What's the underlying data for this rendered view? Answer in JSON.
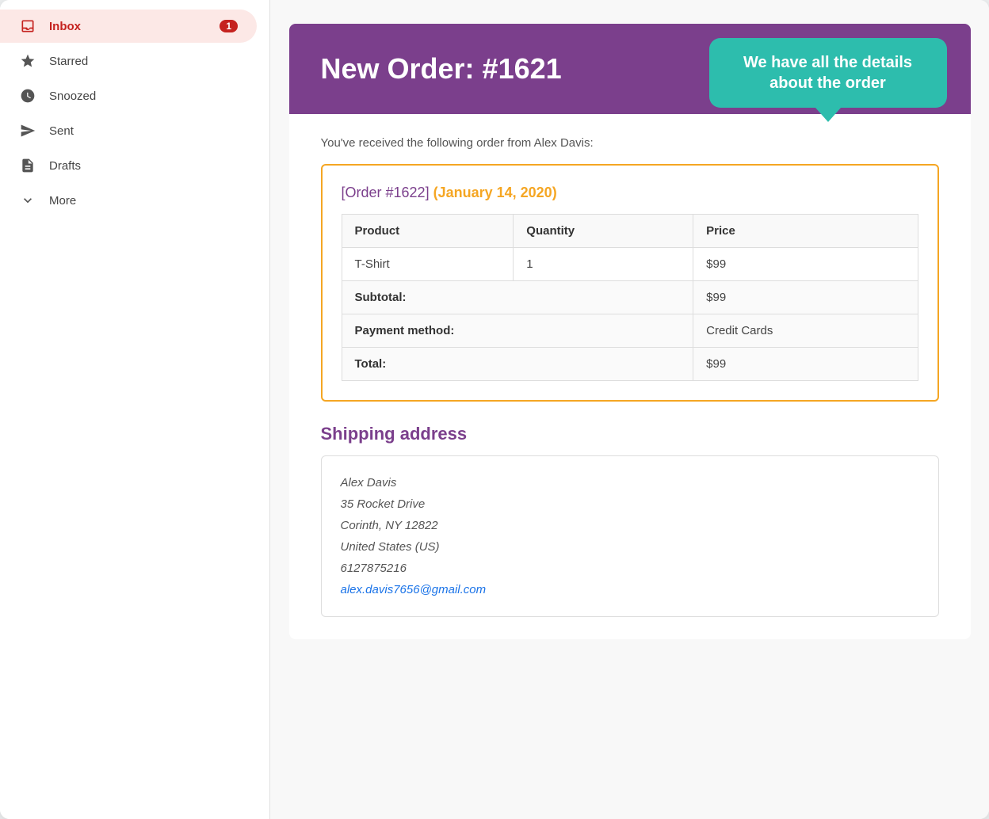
{
  "sidebar": {
    "items": [
      {
        "id": "inbox",
        "label": "Inbox",
        "icon": "inbox",
        "badge": "1",
        "active": true
      },
      {
        "id": "starred",
        "label": "Starred",
        "icon": "star",
        "badge": null,
        "active": false
      },
      {
        "id": "snoozed",
        "label": "Snoozed",
        "icon": "clock",
        "badge": null,
        "active": false
      },
      {
        "id": "sent",
        "label": "Sent",
        "icon": "send",
        "badge": null,
        "active": false
      },
      {
        "id": "drafts",
        "label": "Drafts",
        "icon": "draft",
        "badge": null,
        "active": false
      },
      {
        "id": "more",
        "label": "More",
        "icon": "chevron-down",
        "badge": null,
        "active": false
      }
    ]
  },
  "email": {
    "header": {
      "title": "New Order: #1621",
      "tooltip": "We have all the details about the order"
    },
    "intro": "You've received the following order from Alex Davis:",
    "order": {
      "link_text": "[Order #1622]",
      "date": "(January 14, 2020)",
      "table": {
        "headers": [
          "Product",
          "Quantity",
          "Price"
        ],
        "rows": [
          {
            "product": "T-Shirt",
            "quantity": "1",
            "price": "$99"
          }
        ],
        "summary": [
          {
            "label": "Subtotal:",
            "value": "$99"
          },
          {
            "label": "Payment method:",
            "value": "Credit Cards"
          },
          {
            "label": "Total:",
            "value": "$99"
          }
        ]
      }
    },
    "shipping": {
      "title": "Shipping address",
      "address": {
        "name": "Alex Davis",
        "street": "35 Rocket Drive",
        "city": "Corinth, NY 12822",
        "country": "United States (US)",
        "phone": "6127875216",
        "email": "alex.davis7656@gmail.com"
      }
    }
  },
  "icons": {
    "inbox": "📥",
    "star": "★",
    "clock": "🕐",
    "send": "➤",
    "draft": "📄",
    "chevron_down": "∨"
  }
}
